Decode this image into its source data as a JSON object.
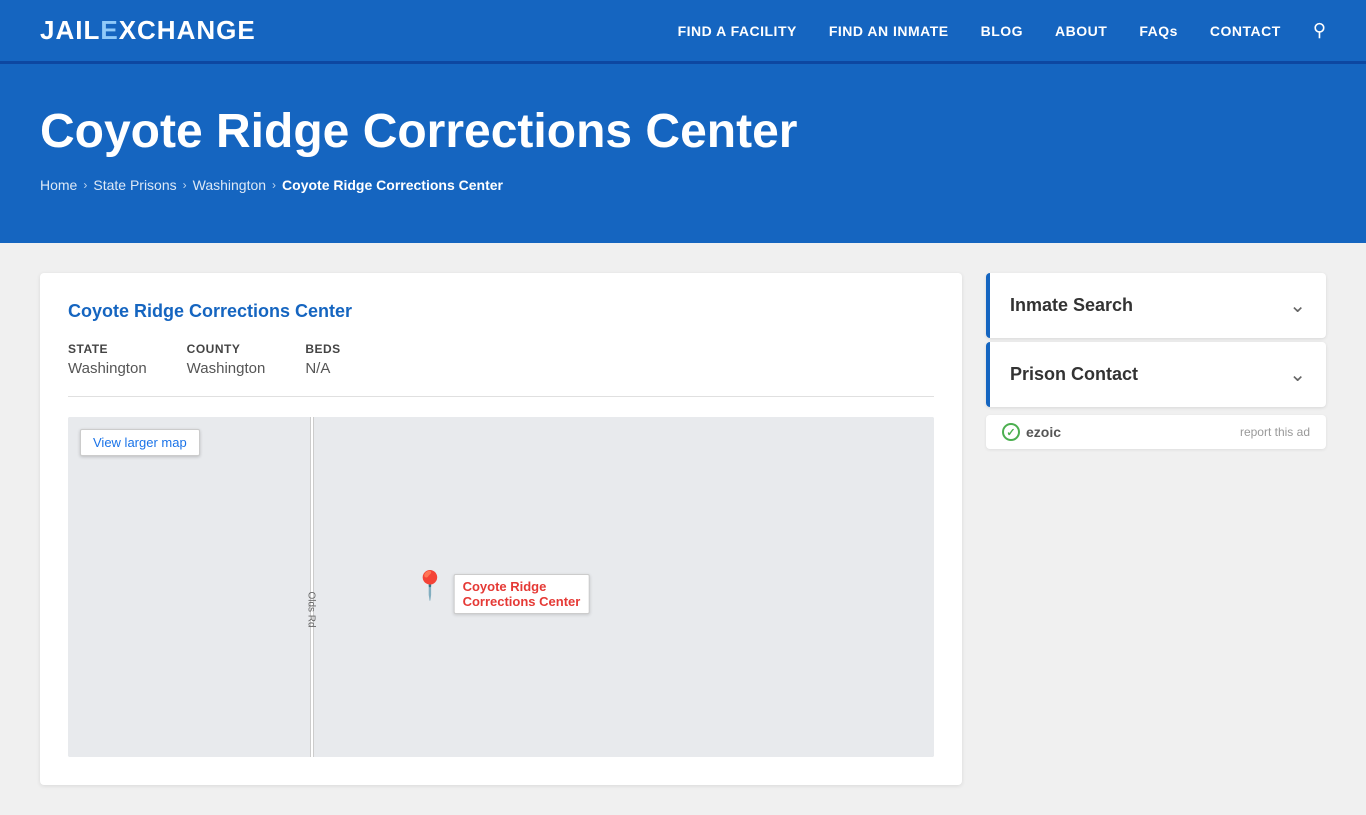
{
  "header": {
    "logo_part1": "JAIL",
    "logo_part2": "E",
    "logo_part3": "XCHANGE",
    "nav": {
      "find_facility": "FIND A FACILITY",
      "find_inmate": "FIND AN INMATE",
      "blog": "BLOG",
      "about": "ABOUT",
      "faqs": "FAQs",
      "contact": "CONTACT"
    }
  },
  "hero": {
    "title": "Coyote Ridge Corrections Center",
    "breadcrumb": {
      "home": "Home",
      "state_prisons": "State Prisons",
      "washington": "Washington",
      "current": "Coyote Ridge Corrections Center"
    }
  },
  "facility": {
    "title": "Coyote Ridge Corrections Center",
    "state_label": "STATE",
    "state_value": "Washington",
    "county_label": "COUNTY",
    "county_value": "Washington",
    "beds_label": "BEDS",
    "beds_value": "N/A",
    "view_larger_map": "View larger map",
    "map_pin_label_line1": "Coyote Ridge",
    "map_pin_label_line2": "Corrections Center",
    "road_label": "Olds Rd"
  },
  "sidebar": {
    "inmate_search": "Inmate Search",
    "prison_contact": "Prison Contact"
  },
  "ezoic": {
    "label": "ezoic",
    "report_ad": "report this ad"
  }
}
